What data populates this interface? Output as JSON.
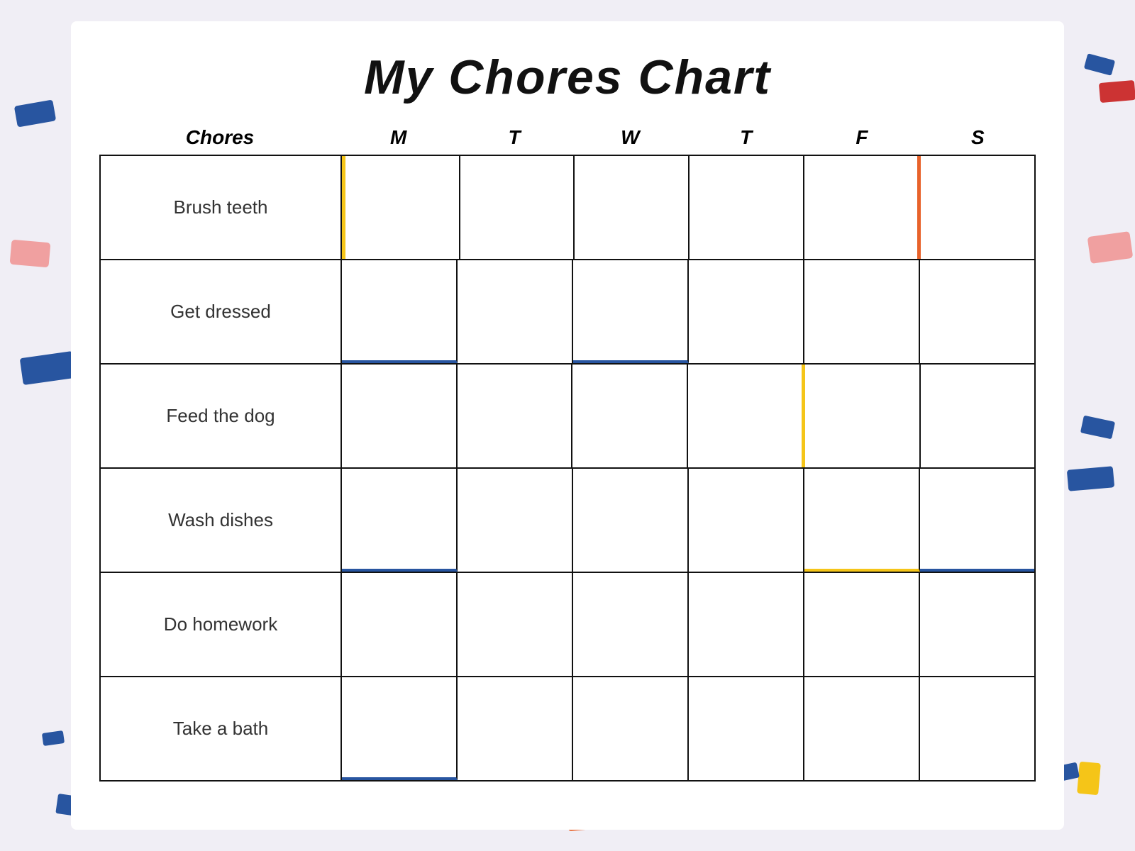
{
  "title": "My Chores Chart",
  "headers": {
    "chores_label": "Chores",
    "days": [
      "M",
      "T",
      "W",
      "T",
      "F",
      "S"
    ]
  },
  "chores": [
    {
      "name": "Brush teeth"
    },
    {
      "name": "Get dressed"
    },
    {
      "name": "Feed the dog"
    },
    {
      "name": "Wash dishes"
    },
    {
      "name": "Do homework"
    },
    {
      "name": "Take a bath"
    }
  ]
}
